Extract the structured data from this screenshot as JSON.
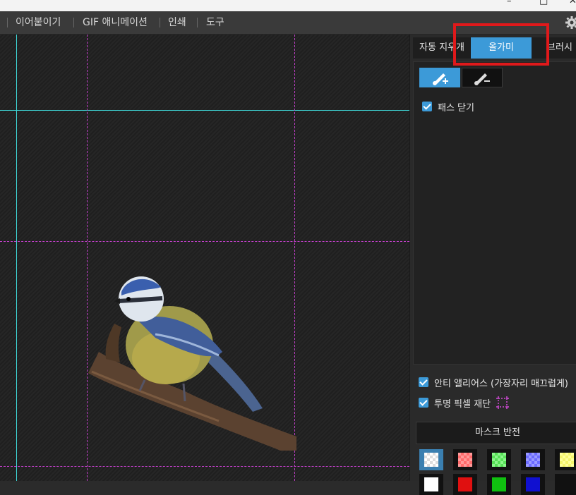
{
  "window": {
    "minimize_glyph": "–",
    "maximize_glyph": "□",
    "close_glyph": "✕"
  },
  "menu": {
    "items": [
      "이어붙이기",
      "GIF 애니메이션",
      "인쇄",
      "도구"
    ],
    "settings_icon": "gear-icon"
  },
  "panel": {
    "tabs": [
      "자동 지우개",
      "올가미",
      "브러시"
    ],
    "active_tab": "올가미",
    "accent_color": "#3c9ad8",
    "highlight_color": "#e0191b",
    "close_path_label": "패스 닫기",
    "close_path_checked": true,
    "antialias_label": "안티 앨리어스 (가장자리 매끄럽게)",
    "antialias_checked": true,
    "trim_label": "투명 픽셀 재단",
    "trim_checked": true,
    "mask_invert_label": "마스크 반전",
    "mask_colors": [
      "transparent",
      "#ff6b6b",
      "#6bff6b",
      "#6b6bff",
      "#ffff6b"
    ],
    "mask_colors_row2": [
      "#ffffff",
      "#e01010",
      "#10c010",
      "#1010d0",
      "#111111"
    ]
  },
  "canvas": {
    "guide_colors": {
      "cyan": "#3ed7d7",
      "magenta": "#c13fc9"
    }
  }
}
